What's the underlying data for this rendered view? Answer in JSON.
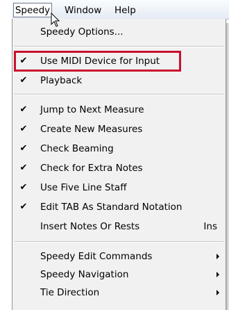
{
  "menubar": {
    "items": [
      "Speedy",
      "Window",
      "Help"
    ]
  },
  "menu": {
    "items": [
      {
        "label": "Speedy Options...",
        "checked": false
      },
      {
        "label": "Use MIDI Device for Input",
        "checked": true,
        "highlighted": true
      },
      {
        "label": "Playback",
        "checked": true
      },
      {
        "label": "Jump to Next Measure",
        "checked": true
      },
      {
        "label": "Create New Measures",
        "checked": true
      },
      {
        "label": "Check Beaming",
        "checked": true
      },
      {
        "label": "Check for Extra Notes",
        "checked": true
      },
      {
        "label": "Use Five Line Staff",
        "checked": true
      },
      {
        "label": "Edit TAB As Standard Notation",
        "checked": true
      },
      {
        "label": "Insert Notes Or Rests",
        "checked": false,
        "shortcut": "Ins"
      },
      {
        "label": "Speedy Edit Commands",
        "checked": false,
        "submenu": true
      },
      {
        "label": "Speedy Navigation",
        "checked": false,
        "submenu": true
      },
      {
        "label": "Tie Direction",
        "checked": false,
        "submenu": true
      }
    ],
    "check_glyph": "✔",
    "highlight_color": "#c8102e"
  }
}
